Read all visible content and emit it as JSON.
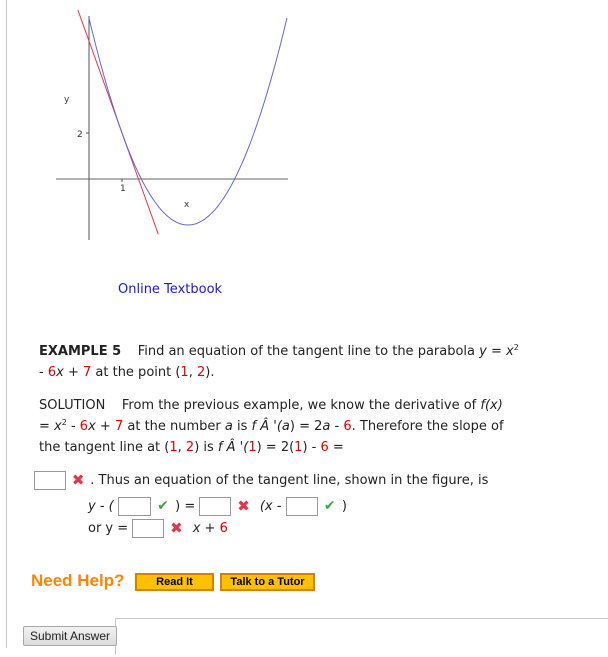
{
  "graph": {
    "axis_label_x": "x",
    "axis_label_y": "y",
    "tick_x": "1",
    "tick_y": "2",
    "parabola": "y = x^2 - 6x + 7",
    "tangent": "y = -4x + 6",
    "x_range": [
      -1,
      6
    ],
    "y_range": [
      -3,
      7
    ],
    "colors": {
      "parabola": "#6666cc",
      "tangent": "#ee3344",
      "axes": "#999999"
    }
  },
  "ebook_link": "Online Textbook",
  "example": {
    "label": "EXAMPLE 5",
    "text1": "Find an equation of the tangent line to the parabola",
    "y": "y",
    "eq": " = ",
    "x": "x",
    "exp": "2",
    "minus": "- ",
    "coef6": "6",
    "xv": "x",
    "plus": " + ",
    "c7": "7",
    "text2": " at the point (",
    "p1": "1",
    "comma": ", ",
    "p2": "2",
    "end": ")."
  },
  "solution": {
    "label": "SOLUTION",
    "line1": "From the previous example, we know the derivative of ",
    "fx": "f(x)",
    "line2a": "= ",
    "line2b": " at the number ",
    "a": "a",
    "is": " is ",
    "fprime": "f Â '(",
    "line2c": ") = 2",
    "line2d": " - ",
    "six": "6",
    "line2e": ". Therefore the slope of",
    "line3a": "the tangent line at (",
    "line3b": ") is ",
    "line3c": "(",
    "line3d": ") = 2(",
    "line3e": ") - ",
    "line3f": " ="
  },
  "answer": {
    "thus": ". Thus an equation of the tangent line, shown in the figure, is",
    "row1_prefix": "y - (",
    "row1_mid": " ) =",
    "row1_paren": "(x -",
    "row1_end": ")",
    "row2_prefix": "or y =",
    "row2_suffix_x": "x + ",
    "row2_suffix_c": "6",
    "inputs": [
      "",
      "",
      "",
      "",
      ""
    ],
    "marks": [
      "incorrect",
      "correct",
      "incorrect",
      "correct",
      "incorrect"
    ]
  },
  "help": {
    "label": "Need Help?",
    "read_it": "Read It",
    "tutor": "Talk to a Tutor"
  },
  "submit": "Submit Answer"
}
